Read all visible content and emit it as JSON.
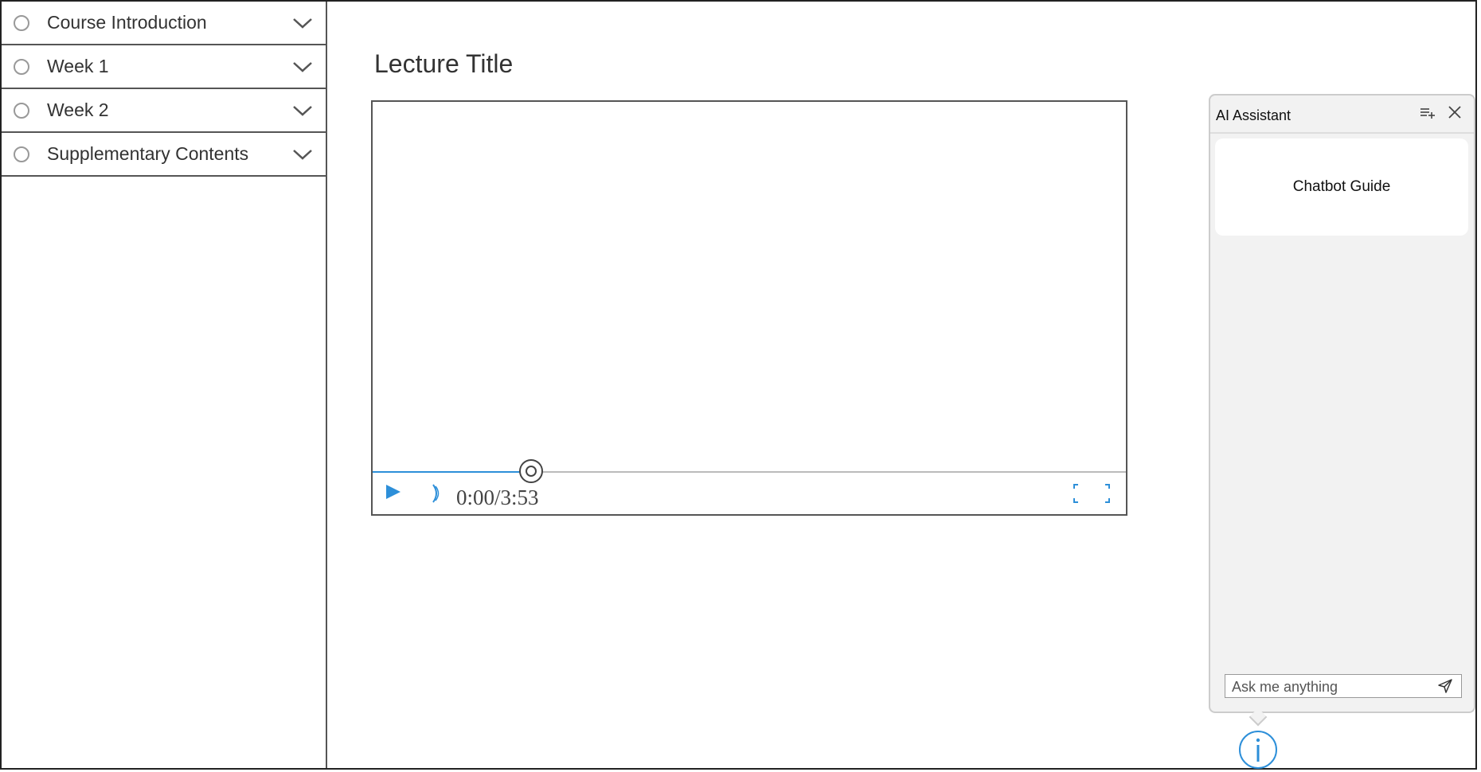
{
  "sidebar": {
    "items": [
      {
        "label": "Course Introduction"
      },
      {
        "label": "Week 1"
      },
      {
        "label": "Week 2"
      },
      {
        "label": "Supplementary Contents"
      }
    ]
  },
  "main": {
    "lecture_title": "Lecture Title",
    "player": {
      "time_display": "0:00/3:53",
      "progress_fraction": 0.21,
      "accent_color": "#2d8fd9"
    }
  },
  "assistant": {
    "title": "AI Assistant",
    "guide_label": "Chatbot Guide",
    "input_placeholder": "Ask me anything"
  },
  "icons": {
    "radio": "radio-circle-icon",
    "expand": "chevron-down-icon",
    "play": "play-icon",
    "volume": "volume-icon",
    "fullscreen": "fullscreen-icon",
    "new_chat": "new-chat-icon",
    "close": "close-icon",
    "send": "send-icon",
    "info": "info-icon"
  }
}
